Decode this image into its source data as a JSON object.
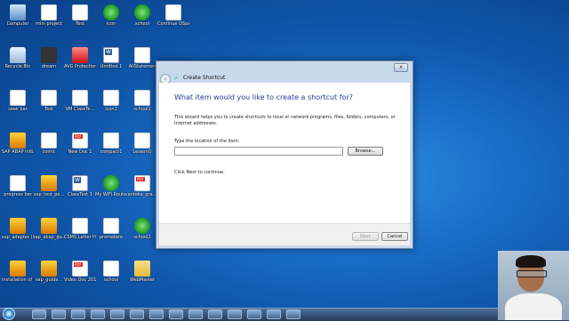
{
  "desktop": {
    "icons": [
      {
        "label": "Computer",
        "icon": "computer-icon"
      },
      {
        "label": "mini project",
        "icon": "file-icon"
      },
      {
        "label": "Test",
        "icon": "file-icon"
      },
      {
        "label": "icon",
        "icon": "green-mushroom-icon"
      },
      {
        "label": "school",
        "icon": "green-mushroom-icon"
      },
      {
        "label": "Continue DSpace I...",
        "icon": "file-icon"
      },
      {
        "label": "Recycle Bin",
        "icon": "recycle-bin-icon"
      },
      {
        "label": "dream",
        "icon": "image-icon"
      },
      {
        "label": "AVG Protection",
        "icon": "app-icon"
      },
      {
        "label": "Untitled 1",
        "icon": "word-doc-icon"
      },
      {
        "label": "AllStatemen",
        "icon": "file-icon"
      },
      {
        "label": "seek bar",
        "icon": "file-icon"
      },
      {
        "label": "Test",
        "icon": "file-icon"
      },
      {
        "label": "VM ClassTe...",
        "icon": "file-icon"
      },
      {
        "label": "icon1",
        "icon": "file-icon"
      },
      {
        "label": "school1",
        "icon": "file-icon"
      },
      {
        "label": "SAP ABAP Initial sta...",
        "icon": "sap-icon"
      },
      {
        "label": "comic",
        "icon": "file-icon"
      },
      {
        "label": "New Doc 1",
        "icon": "pdf-icon"
      },
      {
        "label": "compact1",
        "icon": "file-icon"
      },
      {
        "label": "LessonQ",
        "icon": "file-icon"
      },
      {
        "label": "progress bar",
        "icon": "file-icon"
      },
      {
        "label": "sap_test_po...",
        "icon": "sap-icon"
      },
      {
        "label": "ClassTest 1",
        "icon": "word-doc-icon"
      },
      {
        "label": "My WiFi Router",
        "icon": "wifi-icon"
      },
      {
        "label": "anteka_gra...",
        "icon": "pdf-icon"
      },
      {
        "label": "sap_adapter (3)",
        "icon": "sap-icon"
      },
      {
        "label": "sap_abap_gu...",
        "icon": "sap-icon"
      },
      {
        "label": "CSMS Letter Head",
        "icon": "file-icon"
      },
      {
        "label": "prometere",
        "icon": "file-icon"
      },
      {
        "label": "school2",
        "icon": "green-mushroom-icon"
      },
      {
        "label": "Installation of SAP Sys...",
        "icon": "sap-icon"
      },
      {
        "label": "sap_guide...",
        "icon": "sap-icon"
      },
      {
        "label": "Video Doc 2017 04 02 3...",
        "icon": "pdf-icon"
      },
      {
        "label": "school",
        "icon": "file-icon"
      },
      {
        "label": "WebMaster",
        "icon": "folder-icon"
      }
    ]
  },
  "dialog": {
    "title": "Create Shortcut",
    "close_label": "x",
    "back_label": "‹",
    "heading": "What item would you like to create a shortcut for?",
    "description": "This wizard helps you to create shortcuts to local or network programs, files, folders, computers, or Internet addresses.",
    "location_label": "Type the location of the item:",
    "location_value": "",
    "browse_label": "Browse...",
    "hint": "Click Next to continue.",
    "next_label": "Next",
    "cancel_label": "Cancel"
  },
  "taskbar": {
    "start_label": "⊞",
    "items": [
      {
        "icon": "explorer-icon"
      },
      {
        "icon": "media-icon"
      },
      {
        "icon": "folder-icon"
      },
      {
        "icon": "file-icon"
      },
      {
        "icon": "chrome-icon"
      },
      {
        "icon": "firefox-icon"
      },
      {
        "icon": "paint-icon"
      },
      {
        "icon": "ie-icon"
      },
      {
        "icon": "app-icon"
      },
      {
        "icon": "search-icon"
      },
      {
        "icon": "cmd-icon"
      },
      {
        "icon": "network-icon"
      },
      {
        "icon": "app-icon"
      },
      {
        "icon": "app-icon"
      }
    ]
  }
}
